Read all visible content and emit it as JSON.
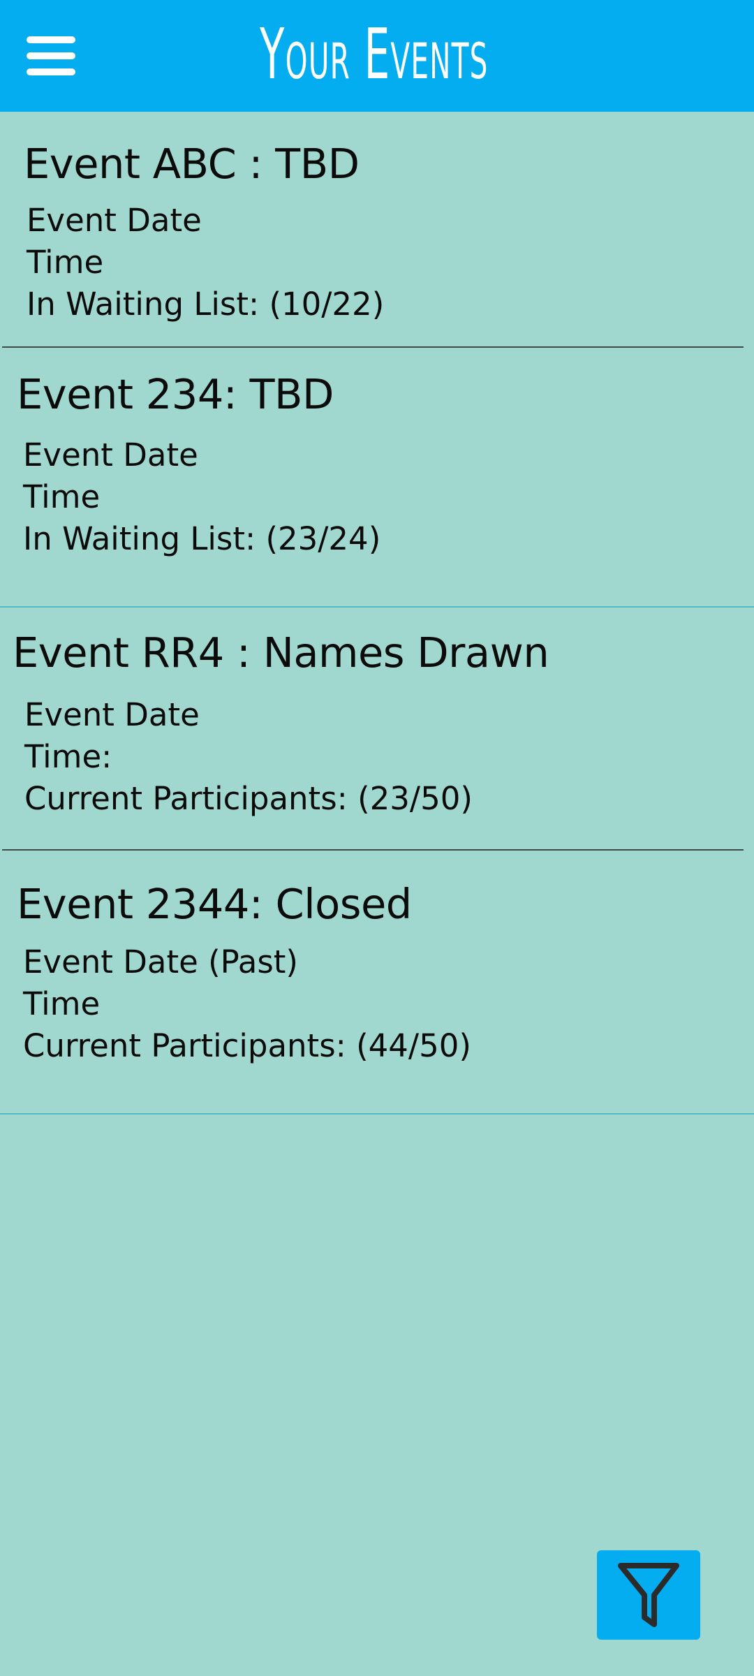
{
  "header": {
    "title": "Your Events",
    "menu_icon": "hamburger-menu-icon"
  },
  "events": [
    {
      "title": "Event ABC : TBD",
      "date": "Event Date",
      "time": "Time",
      "status_line": "In Waiting List: (10/22)"
    },
    {
      "title": "Event 234: TBD",
      "date": "Event Date",
      "time": "Time",
      "status_line": "In Waiting List: (23/24)"
    },
    {
      "title": "Event RR4 : Names Drawn",
      "date": "Event Date",
      "time": "Time:",
      "status_line": "Current Participants: (23/50)"
    },
    {
      "title": "Event 2344: Closed",
      "date": "Event Date (Past)",
      "time": "Time",
      "status_line": "Current Participants: (44/50)"
    }
  ],
  "filter_button": {
    "icon": "filter-icon"
  },
  "colors": {
    "header_background": "#03adef",
    "page_background": "#a0d8cf",
    "fab_background": "#03adef"
  }
}
